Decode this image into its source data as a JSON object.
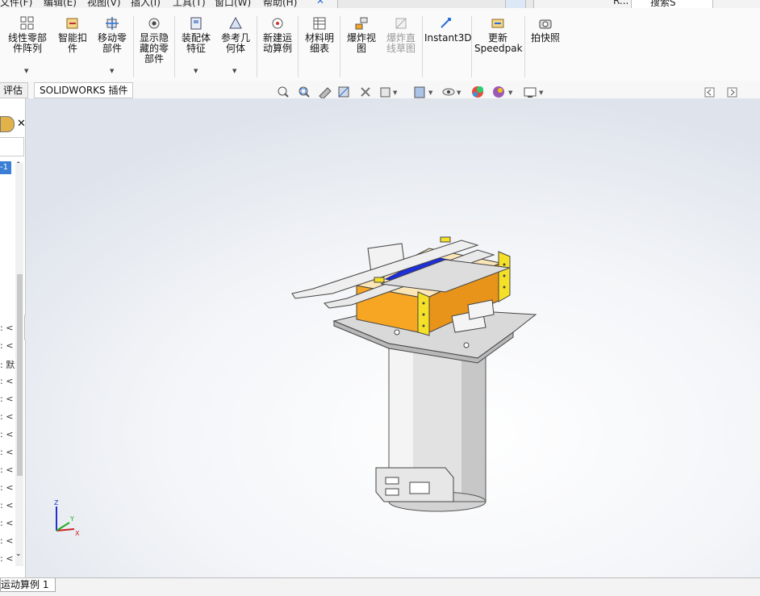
{
  "menu": {
    "items": [
      "文件(F)",
      "编辑(E)",
      "视图(V)",
      "插入(I)",
      "工具(T)",
      "窗口(W)",
      "帮助(H)"
    ],
    "search_label": "搜索S",
    "user_label": "R..."
  },
  "ribbon": {
    "buttons": [
      {
        "label": "线性零部\n件阵列",
        "icon": "linear-pattern-icon"
      },
      {
        "label": "智能扣\n件",
        "icon": "smart-fastener-icon"
      },
      {
        "label": "移动零\n部件",
        "icon": "move-component-icon"
      },
      {
        "label": "显示隐\n藏的零\n部件",
        "icon": "show-hidden-icon"
      },
      {
        "label": "装配体\n特征",
        "icon": "assembly-feature-icon"
      },
      {
        "label": "参考几\n何体",
        "icon": "reference-geometry-icon"
      },
      {
        "label": "新建运\n动算例",
        "icon": "new-motion-study-icon"
      },
      {
        "label": "材料明\n细表",
        "icon": "bom-icon"
      },
      {
        "label": "爆炸视\n图",
        "icon": "exploded-view-icon"
      },
      {
        "label": "爆炸直\n线草图",
        "icon": "explode-line-sketch-icon"
      },
      {
        "label": "Instant3D",
        "icon": "instant3d-icon"
      },
      {
        "label": "更新\nSpeedpak",
        "icon": "speedpak-icon"
      },
      {
        "label": "拍快照",
        "icon": "snapshot-icon"
      }
    ]
  },
  "tabs": {
    "evaluate": "评估",
    "solidworks_addins": "SOLIDWORKS 插件"
  },
  "tree": {
    "top_item": "-1",
    "rows": [
      "<",
      "<",
      "默",
      "<",
      "<",
      "<",
      "<",
      "<",
      "<",
      "<",
      "<",
      "<",
      "<",
      "<"
    ]
  },
  "axes": {
    "x": "X",
    "y": "Y",
    "z": "Z"
  },
  "bottom": {
    "tab_label": "运动算例 1"
  },
  "colors": {
    "orange_box": "#f6a623",
    "yellow_plate": "#f5e028",
    "blue_part": "#1e2fd6",
    "gray_part": "#dcdcdc"
  }
}
